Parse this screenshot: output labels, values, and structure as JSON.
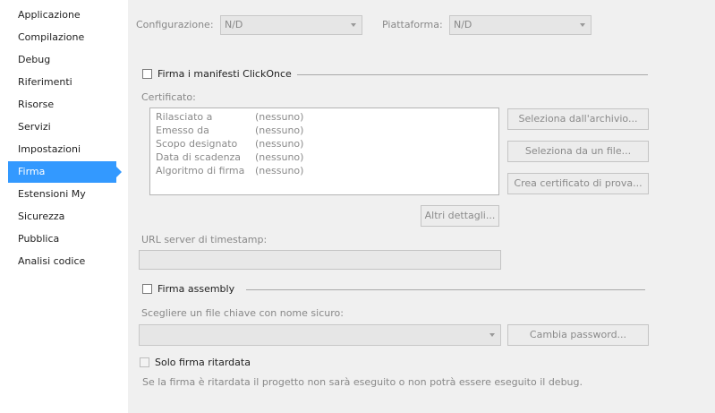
{
  "sidebar": {
    "items": [
      {
        "label": "Applicazione",
        "active": false
      },
      {
        "label": "Compilazione",
        "active": false
      },
      {
        "label": "Debug",
        "active": false
      },
      {
        "label": "Riferimenti",
        "active": false
      },
      {
        "label": "Risorse",
        "active": false
      },
      {
        "label": "Servizi",
        "active": false
      },
      {
        "label": "Impostazioni",
        "active": false
      },
      {
        "label": "Firma",
        "active": true
      },
      {
        "label": "Estensioni My",
        "active": false
      },
      {
        "label": "Sicurezza",
        "active": false
      },
      {
        "label": "Pubblica",
        "active": false
      },
      {
        "label": "Analisi codice",
        "active": false
      }
    ]
  },
  "toolbar": {
    "configuration_label": "Configurazione:",
    "configuration_value": "N/D",
    "platform_label": "Piattaforma:",
    "platform_value": "N/D"
  },
  "clickonce": {
    "checkbox_label": "Firma i manifesti ClickOnce",
    "checked": false,
    "certificate_label": "Certificato:",
    "certificate_rows": [
      {
        "key": "Rilasciato a",
        "value": "(nessuno)"
      },
      {
        "key": "Emesso da",
        "value": "(nessuno)"
      },
      {
        "key": "Scopo designato",
        "value": "(nessuno)"
      },
      {
        "key": "Data di scadenza",
        "value": "(nessuno)"
      },
      {
        "key": "Algoritmo di firma",
        "value": "(nessuno)"
      }
    ],
    "select_from_store_button": "Seleziona dall'archivio...",
    "select_from_file_button": "Seleziona da un file...",
    "create_test_cert_button": "Crea certificato di prova...",
    "more_details_button": "Altri dettagli...",
    "timestamp_label": "URL server di timestamp:",
    "timestamp_value": ""
  },
  "assembly": {
    "checkbox_label": "Firma assembly",
    "checked": false,
    "keyfile_label": "Scegliere un file chiave con nome sicuro:",
    "keyfile_value": "",
    "change_password_button": "Cambia password...",
    "delay_sign_label": "Solo firma ritardata",
    "delay_sign_checked": false,
    "delay_sign_note": "Se la firma è ritardata il progetto non sarà eseguito o non potrà essere eseguito il debug."
  },
  "colors": {
    "active_item_bg": "#3399ff",
    "panel_bg": "#f0f0f0"
  }
}
